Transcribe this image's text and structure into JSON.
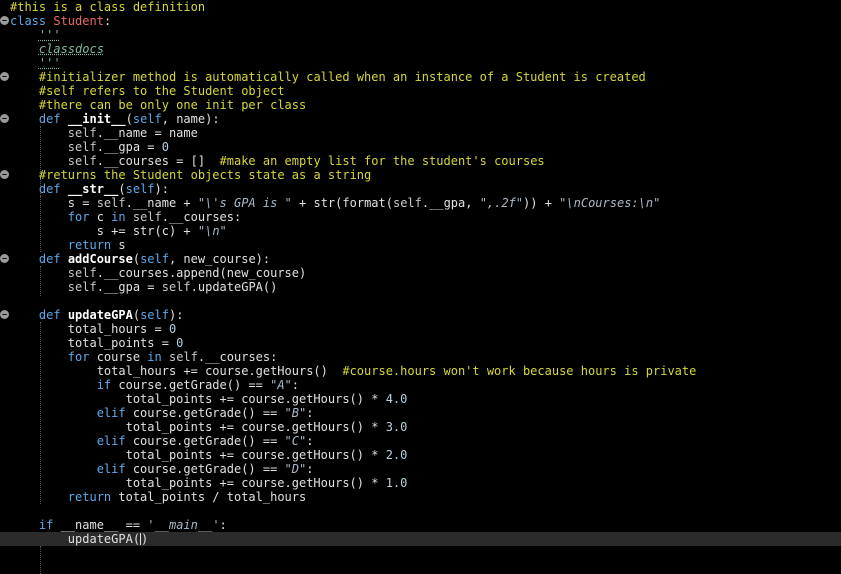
{
  "editor": {
    "language": "python",
    "cursor_line": 38,
    "colors": {
      "background": "#000000",
      "keyword": "#5fa8e8",
      "comment": "#d6d63a",
      "string": "#a8b8c8",
      "class_name": "#e86a6a",
      "number": "#b8d0e0",
      "current_line": "#2b2b2b"
    },
    "lines": [
      {
        "fold": false,
        "tokens": [
          {
            "c": "cm",
            "t": "#this is a class definition"
          }
        ]
      },
      {
        "fold": true,
        "tokens": [
          {
            "c": "k",
            "t": "class "
          },
          {
            "c": "cl",
            "t": "Student"
          },
          {
            "c": "op",
            "t": ":"
          }
        ]
      },
      {
        "fold": false,
        "tokens": [
          {
            "c": "tx",
            "t": "    "
          },
          {
            "c": "dc",
            "t": "'''"
          }
        ]
      },
      {
        "fold": false,
        "tokens": [
          {
            "c": "tx",
            "t": "    "
          },
          {
            "c": "dc",
            "t": "classdocs"
          }
        ]
      },
      {
        "fold": false,
        "tokens": [
          {
            "c": "tx",
            "t": "    "
          },
          {
            "c": "dc",
            "t": "'''"
          }
        ]
      },
      {
        "fold": true,
        "tokens": [
          {
            "c": "tx",
            "t": "    "
          },
          {
            "c": "cm",
            "t": "#initializer method is automatically called when an instance of a Student is created"
          }
        ]
      },
      {
        "fold": false,
        "tokens": [
          {
            "c": "tx",
            "t": "    "
          },
          {
            "c": "cm",
            "t": "#self refers to the Student object"
          }
        ]
      },
      {
        "fold": false,
        "tokens": [
          {
            "c": "tx",
            "t": "    "
          },
          {
            "c": "cm",
            "t": "#there can be only one init per class"
          }
        ]
      },
      {
        "fold": true,
        "tokens": [
          {
            "c": "tx",
            "t": "    "
          },
          {
            "c": "k",
            "t": "def "
          },
          {
            "c": "df",
            "t": "__init__"
          },
          {
            "c": "op",
            "t": "("
          },
          {
            "c": "k",
            "t": "self"
          },
          {
            "c": "op",
            "t": ", name):"
          }
        ]
      },
      {
        "fold": false,
        "tokens": [
          {
            "c": "tx",
            "t": "        "
          },
          {
            "c": "sf",
            "t": "self"
          },
          {
            "c": "op",
            "t": ".__name = name"
          }
        ]
      },
      {
        "fold": false,
        "tokens": [
          {
            "c": "tx",
            "t": "        "
          },
          {
            "c": "sf",
            "t": "self"
          },
          {
            "c": "op",
            "t": ".__gpa = "
          },
          {
            "c": "nm",
            "t": "0"
          }
        ]
      },
      {
        "fold": false,
        "tokens": [
          {
            "c": "tx",
            "t": "        "
          },
          {
            "c": "sf",
            "t": "self"
          },
          {
            "c": "op",
            "t": ".__courses = []  "
          },
          {
            "c": "cm",
            "t": "#make an empty list for the student's courses"
          }
        ]
      },
      {
        "fold": true,
        "tokens": [
          {
            "c": "tx",
            "t": "    "
          },
          {
            "c": "cm",
            "t": "#returns the Student objects state as a string"
          }
        ]
      },
      {
        "fold": false,
        "tokens": [
          {
            "c": "tx",
            "t": "    "
          },
          {
            "c": "k",
            "t": "def "
          },
          {
            "c": "df",
            "t": "__str__"
          },
          {
            "c": "op",
            "t": "("
          },
          {
            "c": "k",
            "t": "self"
          },
          {
            "c": "op",
            "t": "):"
          }
        ]
      },
      {
        "fold": false,
        "tokens": [
          {
            "c": "tx",
            "t": "        s = "
          },
          {
            "c": "sf",
            "t": "self"
          },
          {
            "c": "op",
            "t": ".__name + "
          },
          {
            "c": "st",
            "t": "\"\\'s GPA is \""
          },
          {
            "c": "op",
            "t": " + "
          },
          {
            "c": "bi",
            "t": "str"
          },
          {
            "c": "op",
            "t": "("
          },
          {
            "c": "bi",
            "t": "format"
          },
          {
            "c": "op",
            "t": "("
          },
          {
            "c": "sf",
            "t": "self"
          },
          {
            "c": "op",
            "t": ".__gpa, "
          },
          {
            "c": "st",
            "t": "\",.2f\""
          },
          {
            "c": "op",
            "t": ")) + "
          },
          {
            "c": "st",
            "t": "\"\\nCourses:\\n\""
          }
        ]
      },
      {
        "fold": false,
        "tokens": [
          {
            "c": "tx",
            "t": "        "
          },
          {
            "c": "k",
            "t": "for "
          },
          {
            "c": "tx",
            "t": "c "
          },
          {
            "c": "k",
            "t": "in "
          },
          {
            "c": "sf",
            "t": "self"
          },
          {
            "c": "op",
            "t": ".__courses:"
          }
        ]
      },
      {
        "fold": false,
        "tokens": [
          {
            "c": "tx",
            "t": "            s += "
          },
          {
            "c": "bi",
            "t": "str"
          },
          {
            "c": "op",
            "t": "(c) + "
          },
          {
            "c": "st",
            "t": "\"\\n\""
          }
        ]
      },
      {
        "fold": false,
        "tokens": [
          {
            "c": "tx",
            "t": "        "
          },
          {
            "c": "k",
            "t": "return "
          },
          {
            "c": "tx",
            "t": "s"
          }
        ]
      },
      {
        "fold": true,
        "tokens": [
          {
            "c": "tx",
            "t": "    "
          },
          {
            "c": "k",
            "t": "def "
          },
          {
            "c": "df",
            "t": "addCourse"
          },
          {
            "c": "op",
            "t": "("
          },
          {
            "c": "k",
            "t": "self"
          },
          {
            "c": "op",
            "t": ", new_course):"
          }
        ]
      },
      {
        "fold": false,
        "tokens": [
          {
            "c": "tx",
            "t": "        "
          },
          {
            "c": "sf",
            "t": "self"
          },
          {
            "c": "op",
            "t": ".__courses.append(new_course)"
          }
        ]
      },
      {
        "fold": false,
        "tokens": [
          {
            "c": "tx",
            "t": "        "
          },
          {
            "c": "sf",
            "t": "self"
          },
          {
            "c": "op",
            "t": ".__gpa = "
          },
          {
            "c": "sf",
            "t": "self"
          },
          {
            "c": "op",
            "t": ".updateGPA()"
          }
        ]
      },
      {
        "fold": false,
        "tokens": [
          {
            "c": "tx",
            "t": ""
          }
        ]
      },
      {
        "fold": true,
        "tokens": [
          {
            "c": "tx",
            "t": "    "
          },
          {
            "c": "k",
            "t": "def "
          },
          {
            "c": "df",
            "t": "updateGPA"
          },
          {
            "c": "op",
            "t": "("
          },
          {
            "c": "k",
            "t": "self"
          },
          {
            "c": "op",
            "t": "):"
          }
        ]
      },
      {
        "fold": false,
        "tokens": [
          {
            "c": "tx",
            "t": "        total_hours = "
          },
          {
            "c": "nm",
            "t": "0"
          }
        ]
      },
      {
        "fold": false,
        "tokens": [
          {
            "c": "tx",
            "t": "        total_points = "
          },
          {
            "c": "nm",
            "t": "0"
          }
        ]
      },
      {
        "fold": false,
        "tokens": [
          {
            "c": "tx",
            "t": "        "
          },
          {
            "c": "k",
            "t": "for "
          },
          {
            "c": "tx",
            "t": "course "
          },
          {
            "c": "k",
            "t": "in "
          },
          {
            "c": "sf",
            "t": "self"
          },
          {
            "c": "op",
            "t": ".__courses:"
          }
        ]
      },
      {
        "fold": false,
        "tokens": [
          {
            "c": "tx",
            "t": "            total_hours += course.getHours()  "
          },
          {
            "c": "cm",
            "t": "#course.hours won't work because hours is private"
          }
        ]
      },
      {
        "fold": false,
        "tokens": [
          {
            "c": "tx",
            "t": "            "
          },
          {
            "c": "k",
            "t": "if "
          },
          {
            "c": "tx",
            "t": "course.getGrade() == "
          },
          {
            "c": "st",
            "t": "\"A\""
          },
          {
            "c": "op",
            "t": ":"
          }
        ]
      },
      {
        "fold": false,
        "tokens": [
          {
            "c": "tx",
            "t": "                total_points += course.getHours() * "
          },
          {
            "c": "nm",
            "t": "4.0"
          }
        ]
      },
      {
        "fold": false,
        "tokens": [
          {
            "c": "tx",
            "t": "            "
          },
          {
            "c": "k",
            "t": "elif "
          },
          {
            "c": "tx",
            "t": "course.getGrade() == "
          },
          {
            "c": "st",
            "t": "\"B\""
          },
          {
            "c": "op",
            "t": ":"
          }
        ]
      },
      {
        "fold": false,
        "tokens": [
          {
            "c": "tx",
            "t": "                total_points += course.getHours() * "
          },
          {
            "c": "nm",
            "t": "3.0"
          }
        ]
      },
      {
        "fold": false,
        "tokens": [
          {
            "c": "tx",
            "t": "            "
          },
          {
            "c": "k",
            "t": "elif "
          },
          {
            "c": "tx",
            "t": "course.getGrade() == "
          },
          {
            "c": "st",
            "t": "\"C\""
          },
          {
            "c": "op",
            "t": ":"
          }
        ]
      },
      {
        "fold": false,
        "tokens": [
          {
            "c": "tx",
            "t": "                total_points += course.getHours() * "
          },
          {
            "c": "nm",
            "t": "2.0"
          }
        ]
      },
      {
        "fold": false,
        "tokens": [
          {
            "c": "tx",
            "t": "            "
          },
          {
            "c": "k",
            "t": "elif "
          },
          {
            "c": "tx",
            "t": "course.getGrade() == "
          },
          {
            "c": "st",
            "t": "\"D\""
          },
          {
            "c": "op",
            "t": ":"
          }
        ]
      },
      {
        "fold": false,
        "tokens": [
          {
            "c": "tx",
            "t": "                total_points += course.getHours() * "
          },
          {
            "c": "nm",
            "t": "1.0"
          }
        ]
      },
      {
        "fold": false,
        "tokens": [
          {
            "c": "tx",
            "t": "        "
          },
          {
            "c": "k",
            "t": "return "
          },
          {
            "c": "tx",
            "t": "total_points / total_hours"
          }
        ]
      },
      {
        "fold": false,
        "tokens": [
          {
            "c": "tx",
            "t": ""
          }
        ]
      },
      {
        "fold": false,
        "tokens": [
          {
            "c": "tx",
            "t": "    "
          },
          {
            "c": "k",
            "t": "if "
          },
          {
            "c": "tx",
            "t": "__name__ == "
          },
          {
            "c": "st",
            "t": "'__main__'"
          },
          {
            "c": "op",
            "t": ":"
          }
        ]
      },
      {
        "fold": false,
        "tokens": [
          {
            "c": "tx",
            "t": "        updateGPA("
          },
          {
            "c": "cursor",
            "t": ""
          },
          {
            "c": "tx",
            "t": ")"
          }
        ]
      }
    ]
  }
}
